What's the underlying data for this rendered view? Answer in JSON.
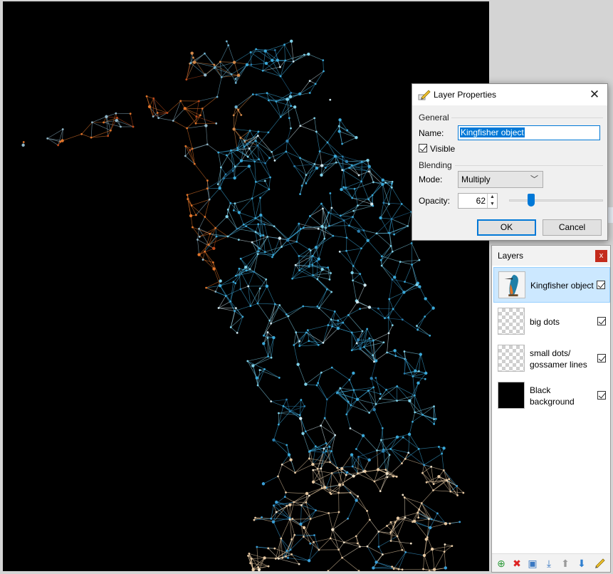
{
  "dialog": {
    "title": "Layer Properties",
    "general_label": "General",
    "name_label": "Name:",
    "name_value": "Kingfisher object",
    "visible_label": "Visible",
    "visible_checked": true,
    "blending_label": "Blending",
    "mode_label": "Mode:",
    "mode_value": "Multiply",
    "opacity_label": "Opacity:",
    "opacity_value": "62",
    "opacity_fraction": 0.62,
    "ok_label": "OK",
    "cancel_label": "Cancel",
    "close_glyph": "✕",
    "icon": "layer-properties-icon"
  },
  "layers_panel": {
    "title": "Layers",
    "close_glyph": "x",
    "layers": [
      {
        "name": "Kingfisher object",
        "visible": true,
        "selected": true,
        "thumb": "kingfisher"
      },
      {
        "name": "big dots",
        "visible": true,
        "selected": false,
        "thumb": "transparent"
      },
      {
        "name": "small dots/ gossamer lines",
        "visible": true,
        "selected": false,
        "thumb": "transparent"
      },
      {
        "name": "Black background",
        "visible": true,
        "selected": false,
        "thumb": "black"
      }
    ],
    "toolbar_icons": [
      "add-layer-icon",
      "delete-layer-icon",
      "duplicate-layer-icon",
      "merge-layer-down-icon",
      "move-layer-up-icon",
      "move-layer-down-icon",
      "layer-properties-icon"
    ]
  },
  "colors": {
    "accent": "#0078d7",
    "canvas_bg": "#000000",
    "selection": "#cce8ff",
    "close_red": "#c42b1c"
  }
}
